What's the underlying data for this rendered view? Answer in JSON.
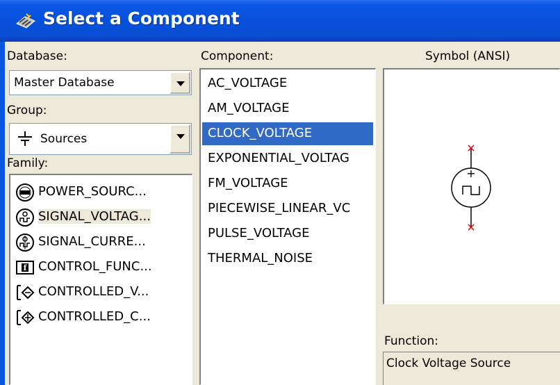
{
  "window": {
    "title": "Select a Component"
  },
  "database": {
    "label": "Database:",
    "value": "Master Database"
  },
  "group": {
    "label": "Group:",
    "value": "Sources"
  },
  "family": {
    "label": "Family:",
    "items": [
      {
        "label": "POWER_SOURC...",
        "icon": "power-source-icon"
      },
      {
        "label": "SIGNAL_VOLTAG...",
        "icon": "signal-voltage-icon",
        "selected": true
      },
      {
        "label": "SIGNAL_CURRE...",
        "icon": "signal-current-icon"
      },
      {
        "label": "CONTROL_FUNC...",
        "icon": "control-function-icon"
      },
      {
        "label": "CONTROLLED_V...",
        "icon": "controlled-voltage-icon"
      },
      {
        "label": "CONTROLLED_C...",
        "icon": "controlled-current-icon"
      }
    ]
  },
  "component": {
    "label": "Component:",
    "items": [
      "AC_VOLTAGE",
      "AM_VOLTAGE",
      "CLOCK_VOLTAGE",
      "EXPONENTIAL_VOLTAG",
      "FM_VOLTAGE",
      "PIECEWISE_LINEAR_VC",
      "PULSE_VOLTAGE",
      "THERMAL_NOISE"
    ],
    "selected": "CLOCK_VOLTAGE"
  },
  "symbol": {
    "label": "Symbol (ANSI)",
    "plus": "+"
  },
  "function": {
    "label": "Function:",
    "value": "Clock Voltage Source"
  },
  "colors": {
    "title_bar": "#0a56e6",
    "selection": "#316ac5",
    "pin_marker": "#e00000"
  }
}
